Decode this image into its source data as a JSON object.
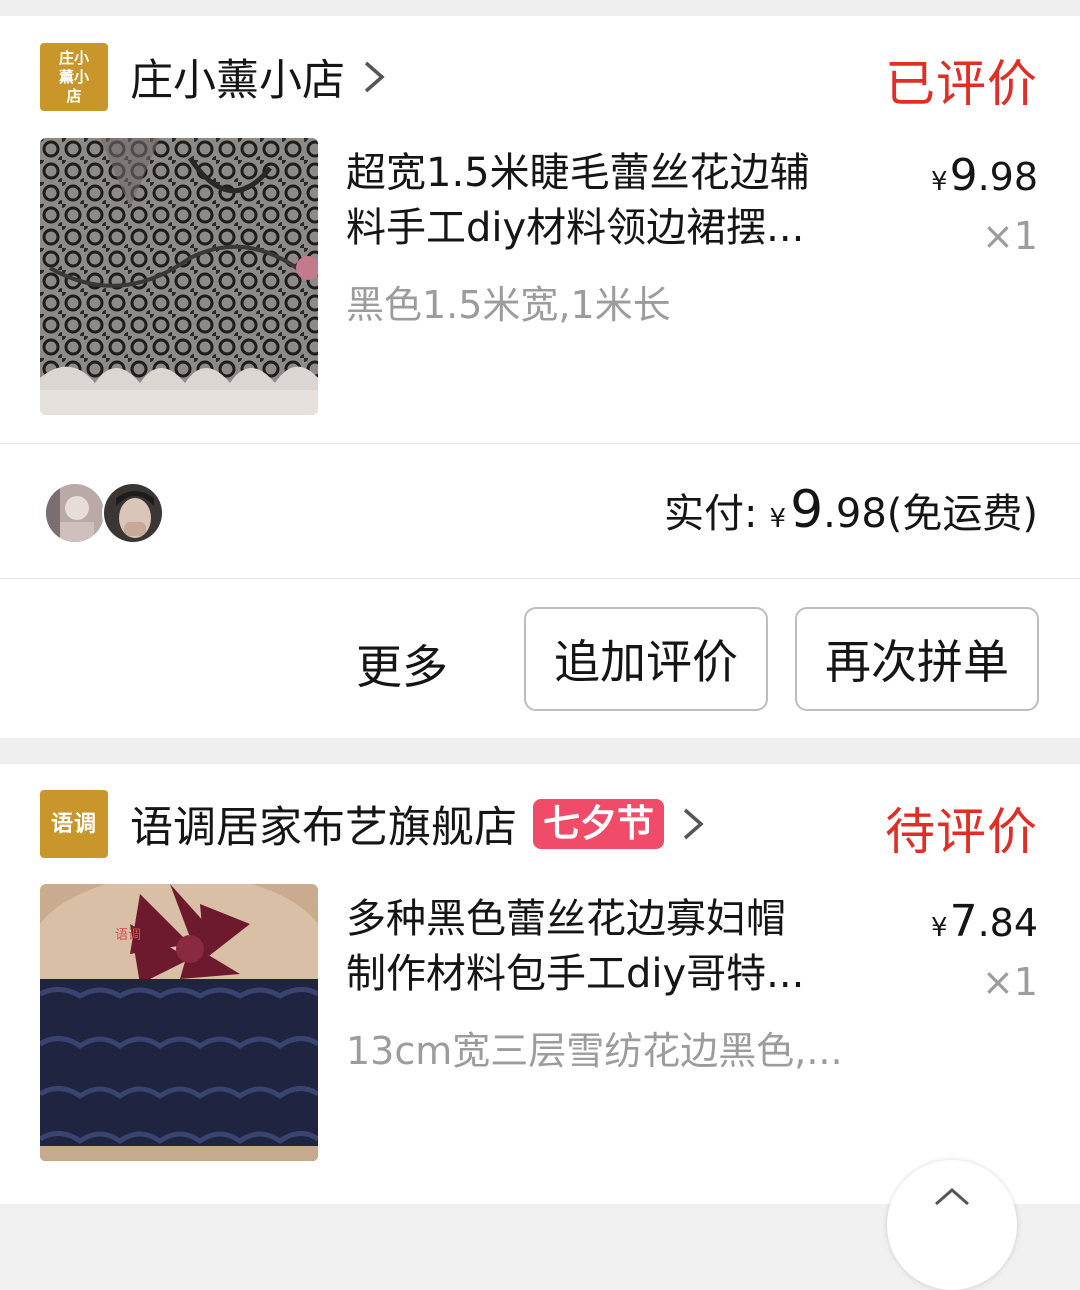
{
  "orders": [
    {
      "shop_logo_text": "庄小薰小店",
      "shop_name": "庄小薰小店",
      "status": "已评价",
      "goods_title_line1": "超宽1.5米睫毛蕾丝花边辅",
      "goods_title_line2": "料手工diy材料领边裙摆...",
      "spec": "黑色1.5米宽,1米长",
      "price_symbol": "¥",
      "price_int": "9",
      "price_dec": ".98",
      "quantity": "×1",
      "pay_label": "实付:",
      "pay_symbol": "¥",
      "pay_int": "9",
      "pay_dec": ".98",
      "pay_note": "(免运费)",
      "more_label": "更多",
      "review_button": "追加评价",
      "rebuy_button": "再次拼单"
    },
    {
      "shop_logo_text": "语调",
      "shop_name": "语调居家布艺旗舰店",
      "festival_badge": "七夕节",
      "status": "待评价",
      "goods_title_line1": "多种黑色蕾丝花边寡妇帽",
      "goods_title_line2": "制作材料包手工diy哥特...",
      "spec": "13cm宽三层雪纺花边黑色,...",
      "price_symbol": "¥",
      "price_int": "7",
      "price_dec": ".84",
      "quantity": "×1",
      "image_watermark": "语调"
    }
  ],
  "colors": {
    "status_red": "#e02e24",
    "badge_pink": "#f04c6a",
    "shop_logo_gold": "#c9962b"
  }
}
